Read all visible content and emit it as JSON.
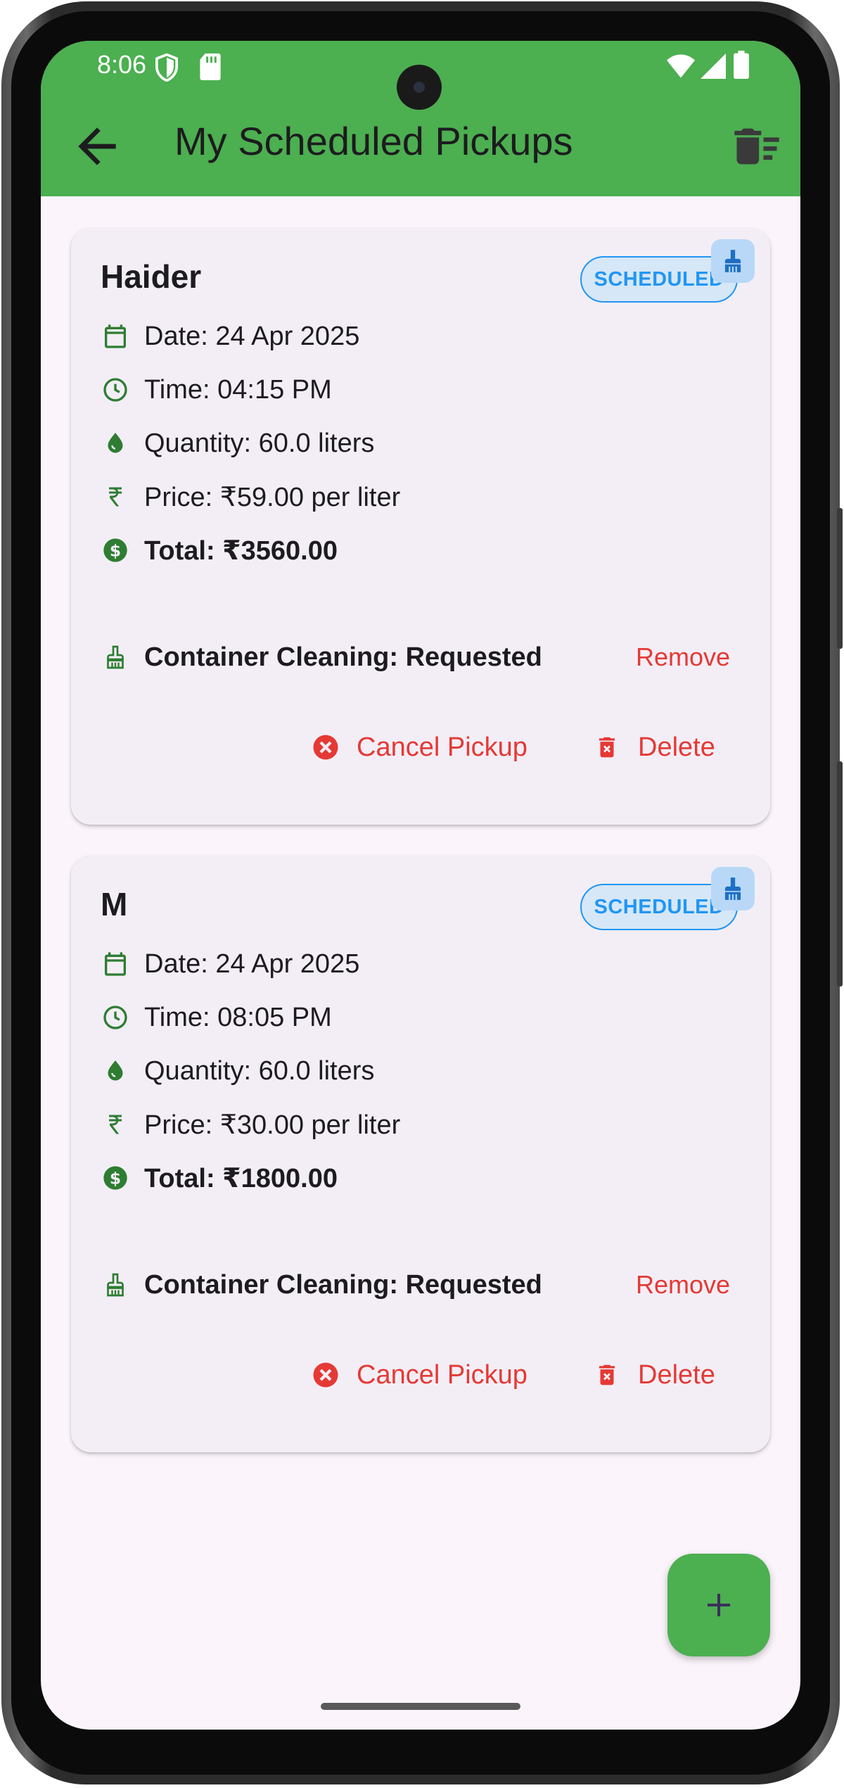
{
  "status_bar": {
    "time": "8:06"
  },
  "app_bar": {
    "title": "My Scheduled Pickups",
    "back_icon": "arrow-back-icon",
    "clear_all_icon": "delete-sweep-icon"
  },
  "colors": {
    "primary": "#4caf50",
    "danger": "#e53935",
    "status_blue": "#2196f3",
    "icon_green": "#2e7d32"
  },
  "pickups": [
    {
      "name": "Haider",
      "status": "SCHEDULED",
      "date": "Date: 24 Apr 2025",
      "time": "Time: 04:15 PM",
      "quantity": "Quantity: 60.0 liters",
      "price": "Price: ₹59.00 per liter",
      "total": "Total: ₹3560.00",
      "cleaning": "Container Cleaning: Requested",
      "remove_label": "Remove",
      "cancel_label": "Cancel Pickup",
      "delete_label": "Delete"
    },
    {
      "name": "M",
      "status": "SCHEDULED",
      "date": "Date: 24 Apr 2025",
      "time": "Time: 08:05 PM",
      "quantity": "Quantity: 60.0 liters",
      "price": "Price: ₹30.00 per liter",
      "total": "Total: ₹1800.00",
      "cleaning": "Container Cleaning: Requested",
      "remove_label": "Remove",
      "cancel_label": "Cancel Pickup",
      "delete_label": "Delete"
    }
  ],
  "fab": {
    "icon": "plus-icon"
  }
}
